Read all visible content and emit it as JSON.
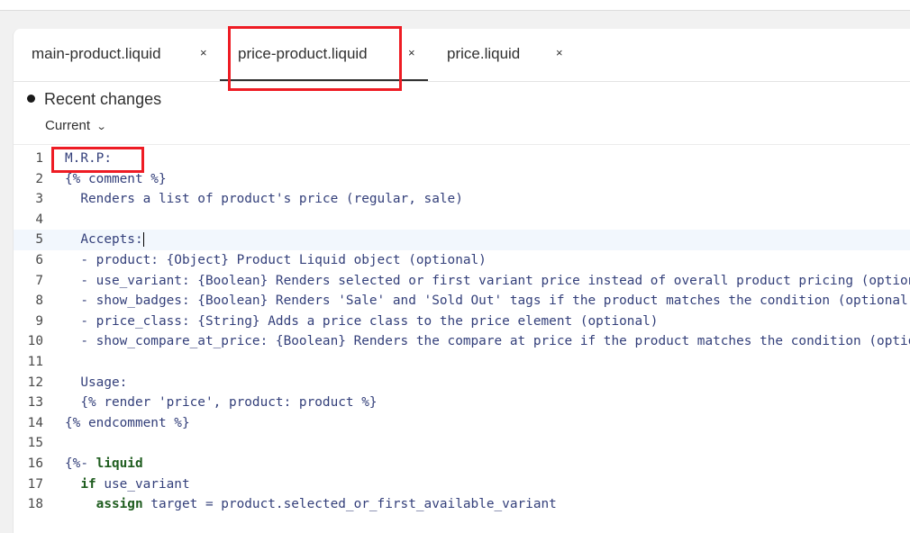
{
  "tabs": [
    {
      "label": "main-product.liquid",
      "close": "×"
    },
    {
      "label": "price-product.liquid",
      "close": "×"
    },
    {
      "label": "price.liquid",
      "close": "×"
    }
  ],
  "recent": {
    "title": "Recent changes",
    "current": "Current",
    "chevron": "⌄"
  },
  "editor": {
    "active_line": 5,
    "lines": [
      {
        "n": "1",
        "text": "M.R.P:"
      },
      {
        "n": "2",
        "text": "{% comment %}"
      },
      {
        "n": "3",
        "text": "  Renders a list of product's price (regular, sale)"
      },
      {
        "n": "4",
        "text": ""
      },
      {
        "n": "5",
        "text": "  Accepts:"
      },
      {
        "n": "6",
        "text": "  - product: {Object} Product Liquid object (optional)"
      },
      {
        "n": "7",
        "text": "  - use_variant: {Boolean} Renders selected or first variant price instead of overall product pricing (optional)"
      },
      {
        "n": "8",
        "text": "  - show_badges: {Boolean} Renders 'Sale' and 'Sold Out' tags if the product matches the condition (optional)"
      },
      {
        "n": "9",
        "text": "  - price_class: {String} Adds a price class to the price element (optional)"
      },
      {
        "n": "10",
        "text": "  - show_compare_at_price: {Boolean} Renders the compare at price if the product matches the condition (optional)"
      },
      {
        "n": "11",
        "text": ""
      },
      {
        "n": "12",
        "text": "  Usage:"
      },
      {
        "n": "13",
        "text": "  {% render 'price', product: product %}"
      },
      {
        "n": "14",
        "text": "{% endcomment %}"
      },
      {
        "n": "15",
        "text": ""
      },
      {
        "n": "16",
        "pre": "{%- ",
        "kw": "liquid",
        "post": ""
      },
      {
        "n": "17",
        "pre": "  ",
        "kw": "if",
        "post": " use_variant"
      },
      {
        "n": "18",
        "pre": "    ",
        "kw": "assign",
        "post": " target = product.selected_or_first_available_variant"
      }
    ]
  }
}
